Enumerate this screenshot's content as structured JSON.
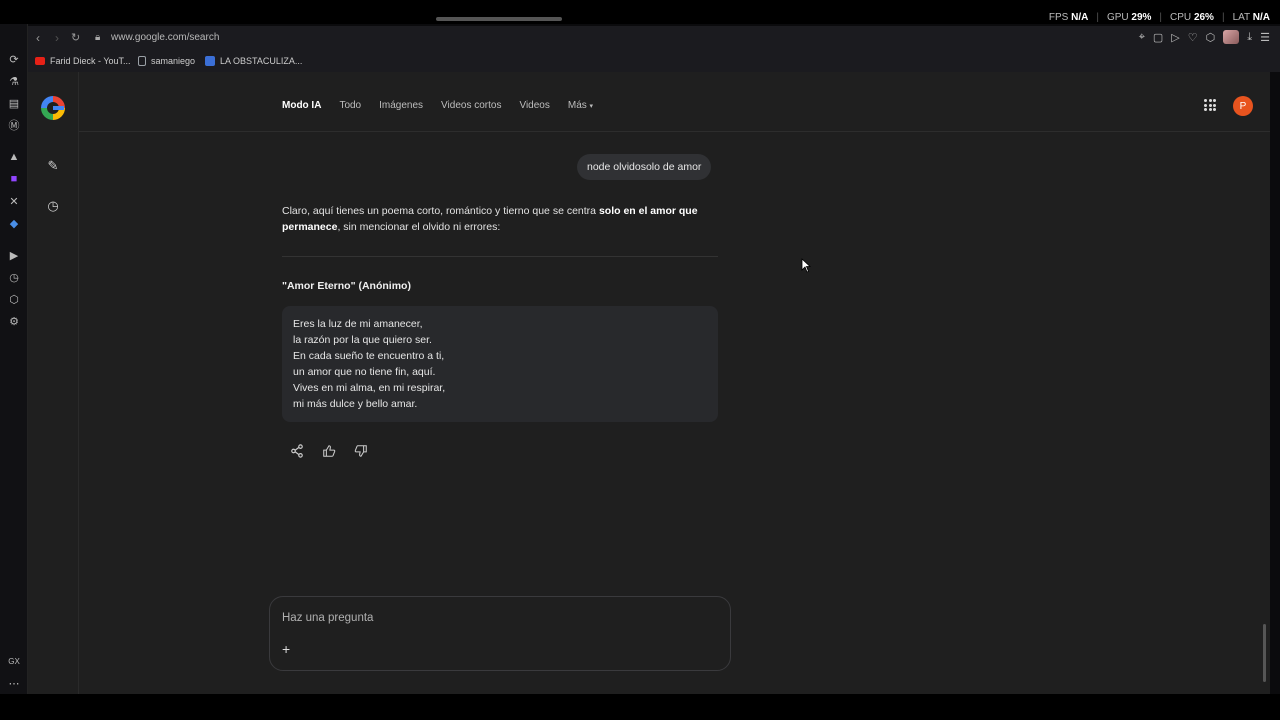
{
  "stats": {
    "fps_label": "FPS",
    "fps_value": "N/A",
    "gpu_label": "GPU",
    "gpu_value": "29%",
    "cpu_label": "CPU",
    "cpu_value": "26%",
    "lat_label": "LAT",
    "lat_value": "N/A"
  },
  "browser": {
    "url": "www.google.com/search"
  },
  "bookmarks": [
    {
      "label": "Farid Dieck - YouT...",
      "color": "#e62117"
    },
    {
      "label": "samaniego",
      "color": "#9aa0a6"
    },
    {
      "label": "LA OBSTACULIZA...",
      "color": "#3b6fd6"
    }
  ],
  "google": {
    "tabs": [
      "Modo IA",
      "Todo",
      "Imágenes",
      "Videos cortos",
      "Videos",
      "Más"
    ],
    "profile_initial": "P",
    "user_query": "node olvidosolo de amor",
    "answer_intro_1": "Claro, aquí tienes un poema corto, romántico y tierno que se centra ",
    "answer_bold": "solo en el amor que permanece",
    "answer_intro_2": ", sin mencionar el olvido ni errores:",
    "poem_title": "\"Amor Eterno\" (Anónimo)",
    "poem_lines": [
      "Eres la luz de mi amanecer,",
      "la razón por la que quiero ser.",
      "En cada sueño te encuentro a ti,",
      "un amor que no tiene fin, aquí.",
      "Vives en mi alma, en mi respirar,",
      "mi más dulce y bello amar."
    ],
    "ask_placeholder": "Haz una pregunta",
    "plus_label": "+"
  },
  "colors": {
    "accent_profile": "#e8541f",
    "page_bg": "#1f1f1f"
  }
}
